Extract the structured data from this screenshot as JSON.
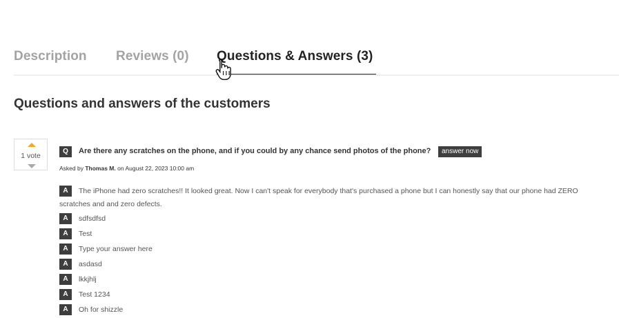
{
  "tabs": [
    {
      "label": "Description"
    },
    {
      "label": "Reviews (0)"
    },
    {
      "label": "Questions & Answers (3)"
    }
  ],
  "section_title": "Questions and answers of the customers",
  "question": {
    "votes": "1 vote",
    "badge": "Q",
    "text": "Are there any scratches on the phone, and if you could by any chance send photos of the phone?",
    "answer_now_label": "answer now",
    "asked_by_prefix": "Asked by",
    "author": "Thomas M.",
    "date_text": "on August 22, 2023 10:00 am"
  },
  "answers": [
    {
      "badge": "A",
      "text": "The iPhone had zero scratches!! It looked great. Now I can't speak for everybody that's purchased a phone but I can honestly say that our phone had ZERO scratches and and zero defects."
    },
    {
      "badge": "A",
      "text": "sdfsdfsd"
    },
    {
      "badge": "A",
      "text": "Test"
    },
    {
      "badge": "A",
      "text": "Type your answer here"
    },
    {
      "badge": "A",
      "text": "asdasd"
    },
    {
      "badge": "A",
      "text": "lkkjhlj"
    },
    {
      "badge": "A",
      "text": "Test 1234"
    },
    {
      "badge": "A",
      "text": "Oh for shizzle"
    }
  ],
  "colors": {
    "vote_up": "#f0a82a",
    "badge_bg": "#3e3e3e",
    "active_tab": "#222222",
    "inactive_tab": "#a3a3a3"
  }
}
